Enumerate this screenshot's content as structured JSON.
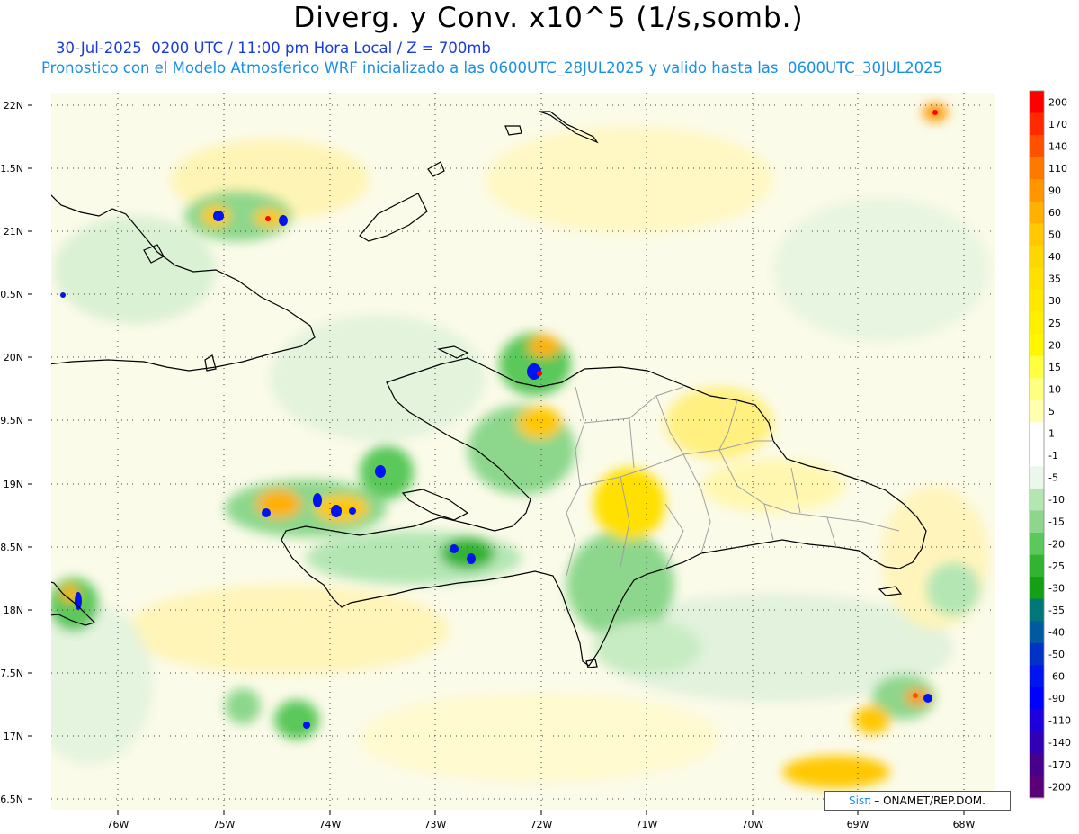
{
  "header": {
    "title": "Diverg. y Conv. x10^5 (1/s,somb.)",
    "subtitle_line1": "30-Jul-2025  0200 UTC / 11:00 pm Hora Local / Z = 700mb",
    "subtitle_line2": "Pronostico con el Modelo Atmosferico WRF inicializado a las 0600UTC_28JUL2025 y valido hasta las  0600UTC_30JUL2025"
  },
  "map": {
    "lat_labels": [
      "22N",
      "21.5N",
      "21N",
      "20.5N",
      "20N",
      "19.5N",
      "19N",
      "18.5N",
      "18N",
      "17.5N",
      "17N",
      "16.5N"
    ],
    "lon_labels": [
      "76W",
      "75W",
      "74W",
      "73W",
      "72W",
      "71W",
      "70W",
      "69W",
      "68W"
    ],
    "land_line_color": "#000000",
    "province_line_color": "#a0a0a0"
  },
  "colorbar": {
    "labels": [
      "200",
      "170",
      "140",
      "110",
      "90",
      "60",
      "50",
      "40",
      "35",
      "30",
      "25",
      "20",
      "15",
      "10",
      "5",
      "1",
      "-1",
      "-5",
      "-10",
      "-15",
      "-20",
      "-25",
      "-30",
      "-35",
      "-40",
      "-50",
      "-60",
      "-90",
      "-110",
      "-140",
      "-170",
      "-200"
    ],
    "colors": [
      "#ff0000",
      "#ff2a00",
      "#ff5000",
      "#ff7800",
      "#ff9600",
      "#ffb000",
      "#ffc800",
      "#ffd700",
      "#ffe000",
      "#ffe800",
      "#fff000",
      "#fff700",
      "#ffff40",
      "#ffff80",
      "#ffffb0",
      "#ffffff",
      "#ffffff",
      "#ebf7eb",
      "#b4e6b4",
      "#8cd78c",
      "#5ac85a",
      "#32b432",
      "#14a014",
      "#007878",
      "#005aa0",
      "#0032c8",
      "#0014f0",
      "#0000ff",
      "#1e00dc",
      "#3200b4",
      "#46008c",
      "#5a0078"
    ]
  },
  "credit": {
    "logo": "Sisπ",
    "text": "– ONAMET/REP.DOM."
  }
}
